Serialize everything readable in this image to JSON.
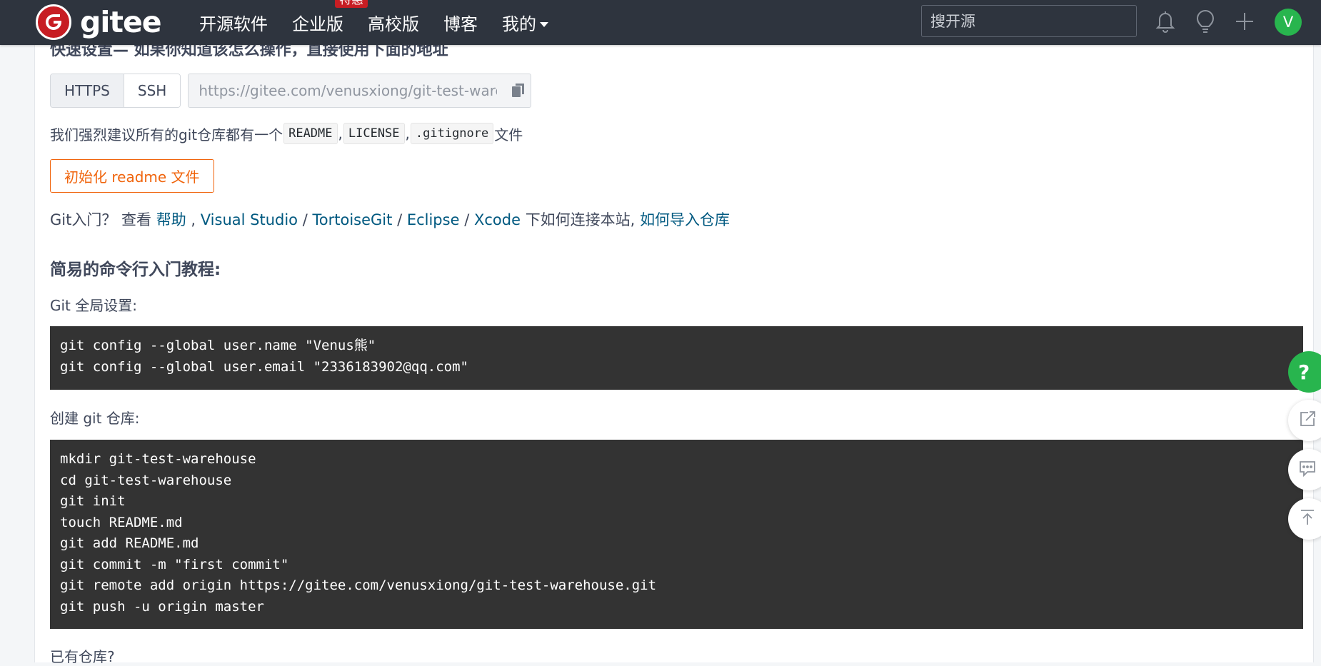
{
  "nav": {
    "logo_text": "gitee",
    "items": [
      {
        "label": "开源软件"
      },
      {
        "label": "企业版",
        "badge": "特惠"
      },
      {
        "label": "高校版"
      },
      {
        "label": "博客"
      },
      {
        "label": "我的"
      }
    ],
    "search_placeholder": "搜开源",
    "avatar_letter": "V",
    "brand_color": "#c71d23"
  },
  "quick_setup": {
    "heading": "快速设置— 如果你知道该怎么操作，直接使用下面的地址",
    "protocols": [
      "HTTPS",
      "SSH"
    ],
    "clone_url": "https://gitee.com/venusxiong/git-test-warehouse.git",
    "suggest_prefix": "我们强烈建议所有的git仓库都有一个",
    "suggest_files": [
      "README",
      "LICENSE",
      ".gitignore"
    ],
    "suggest_sep": ",",
    "suggest_suffix": "文件",
    "init_button": "初始化 readme 文件"
  },
  "help_line": {
    "prefix": "Git入门？ 查看",
    "links": [
      "帮助",
      "Visual Studio",
      "TortoiseGit",
      "Eclipse",
      "Xcode"
    ],
    "sep_comma": ",",
    "sep_slash": "/",
    "middle": "下如何连接本站,",
    "import_link": "如何导入仓库"
  },
  "tutorial": {
    "title": "简易的命令行入门教程:",
    "global_label": "Git 全局设置:",
    "global_commands": [
      "git config --global user.name \"Venus熊\"",
      "git config --global user.email \"2336183902@qq.com\""
    ],
    "create_label": "创建 git 仓库:",
    "create_commands": [
      "mkdir git-test-warehouse",
      "cd git-test-warehouse",
      "git init",
      "touch README.md",
      "git add README.md",
      "git commit -m \"first commit\"",
      "git remote add origin https://gitee.com/venusxiong/git-test-warehouse.git",
      "git push -u origin master"
    ],
    "existing_label": "已有仓库?"
  },
  "float_tools": {
    "help_glyph": "?"
  }
}
